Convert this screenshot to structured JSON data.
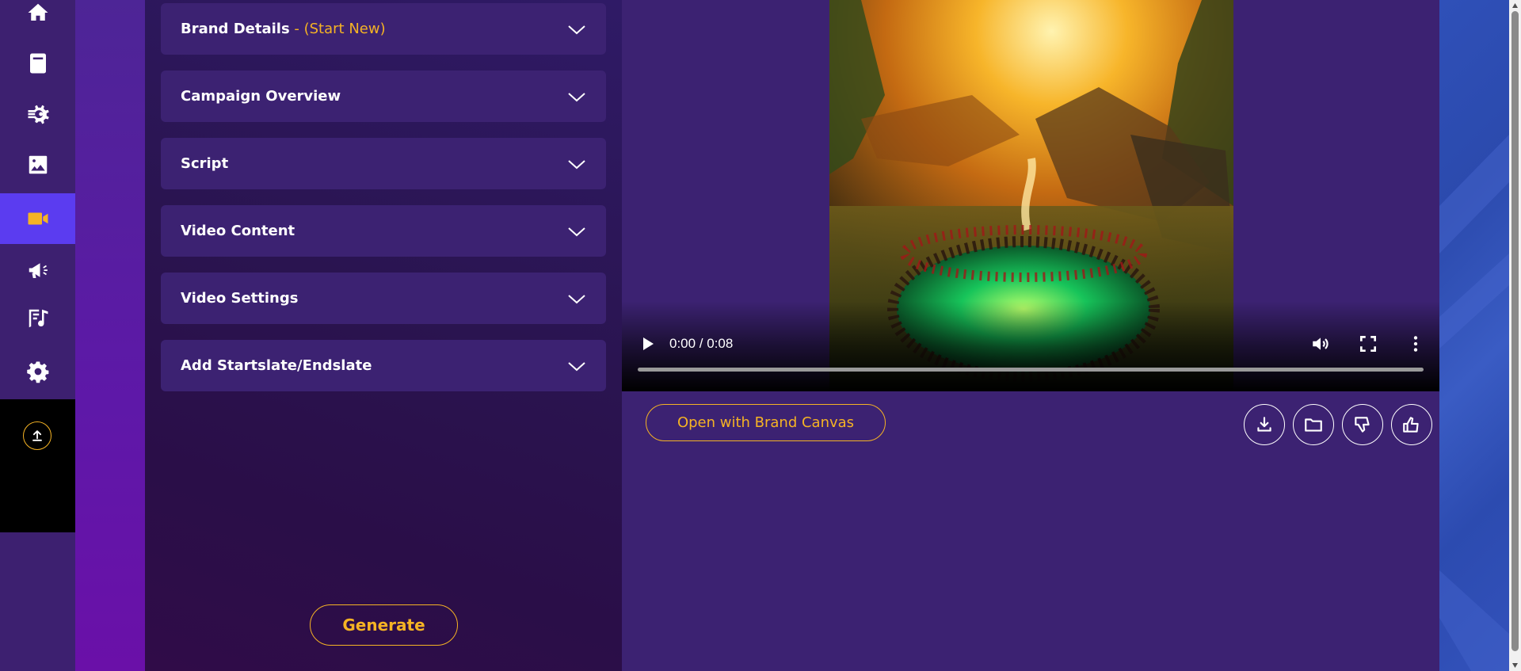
{
  "sidebar": {
    "items": [
      {
        "icon": "home-icon"
      },
      {
        "icon": "document-icon"
      },
      {
        "icon": "automation-gear-icon"
      },
      {
        "icon": "image-icon"
      },
      {
        "icon": "video-camera-icon",
        "active": true
      },
      {
        "icon": "megaphone-icon"
      },
      {
        "icon": "music-note-icon"
      },
      {
        "icon": "settings-gear-icon"
      }
    ],
    "upload_icon": "upload-icon"
  },
  "form": {
    "sections": [
      {
        "title": "Brand Details",
        "subtitle": " - (Start New)"
      },
      {
        "title": "Campaign Overview",
        "subtitle": ""
      },
      {
        "title": "Script",
        "subtitle": ""
      },
      {
        "title": "Video Content",
        "subtitle": ""
      },
      {
        "title": "Video Settings",
        "subtitle": ""
      },
      {
        "title": "Add Startslate/Endslate",
        "subtitle": ""
      }
    ],
    "generate_label": "Generate"
  },
  "video": {
    "time_display": "0:00 / 0:08",
    "progress": 0.0,
    "open_brand_canvas_label": "Open with Brand Canvas",
    "actions": [
      "download-icon",
      "folder-icon",
      "thumbs-down-icon",
      "thumbs-up-icon"
    ]
  },
  "colors": {
    "accent": "#f5b324",
    "active_nav": "#5b3cf0",
    "panel": "#3c2272"
  }
}
